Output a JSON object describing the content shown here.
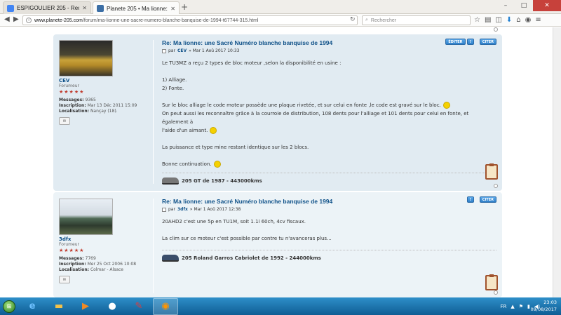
{
  "browser": {
    "tabs": [
      {
        "label": "ESPIGOULIER 205 - Recherch...",
        "active": false
      },
      {
        "label": "Planete 205 • Ma lionne: une...",
        "active": true
      }
    ],
    "new_tab": "+",
    "url": {
      "domain": "www.planete-205.com",
      "path": "/forum/ma-lionne-une-sacre-numero-blanche-banquise-de-1994-t67744-315.html"
    },
    "search_placeholder": "Rechercher",
    "window_controls": {
      "minimize": "–",
      "maximize": "□",
      "close": "✕"
    }
  },
  "posts": [
    {
      "author": "CEV",
      "rank": "Forumeur",
      "stars": "★★★★★",
      "stats": {
        "messages_label": "Messages:",
        "messages": "9365",
        "inscription_label": "Inscription:",
        "inscription": "Mar 13 Déc 2011 15:09",
        "localisation_label": "Localisation:",
        "localisation": "Nançay (18)."
      },
      "title": "Re: Ma lionne: une Sacré Numéro blanche banquise de 1994",
      "meta_prefix": "par",
      "meta_date": "» Mar 1 Aoû 2017 10:33",
      "buttons": {
        "edit": "ÉDITER",
        "info": "!",
        "quote": "CITER"
      },
      "lines": [
        "Le TU3MZ a reçu 2 types de bloc moteur ,selon la disponibilité en usine :",
        "",
        "1) Alliage.",
        "2) Fonte.",
        "",
        "Sur le bloc alliage le code moteur possède une plaque rivetée, et sur celui en fonte ,le code est gravé sur le bloc.",
        "On peut aussi les reconnaître grâce à la courroie de distribution, 108 dents pour l'alliage et 101 dents pour celui en fonte, et également à",
        "l'aide d'un aimant.",
        "",
        "La puissance et type mine restant identique sur les 2 blocs.",
        "",
        "Bonne continuation."
      ],
      "signature": "205 GT de 1987 - 443000kms"
    },
    {
      "author": "3dfx",
      "rank": "Forumeur",
      "stars": "★★★★★",
      "stats": {
        "messages_label": "Messages:",
        "messages": "7769",
        "inscription_label": "Inscription:",
        "inscription": "Mer 25 Oct 2006 10:08",
        "localisation_label": "Localisation:",
        "localisation": "Colmar - Alsace"
      },
      "title": "Re: Ma lionne: une Sacré Numéro blanche banquise de 1994",
      "meta_prefix": "par",
      "meta_date": "» Mar 1 Aoû 2017 12:38",
      "buttons": {
        "info": "!",
        "quote": "CITER"
      },
      "lines": [
        "20AHD2 c'est une 5p en TU1M, soit 1.1i 60ch, 4cv fiscaux.",
        "",
        "La clim sur ce moteur c'est possible par contre tu n'avanceras plus..."
      ],
      "signature": "205 Roland Garros Cabriolet de 1992 - 244000kms"
    }
  ],
  "taskbar": {
    "lang": "FR",
    "time": "23:03",
    "date": "09/08/2017"
  }
}
